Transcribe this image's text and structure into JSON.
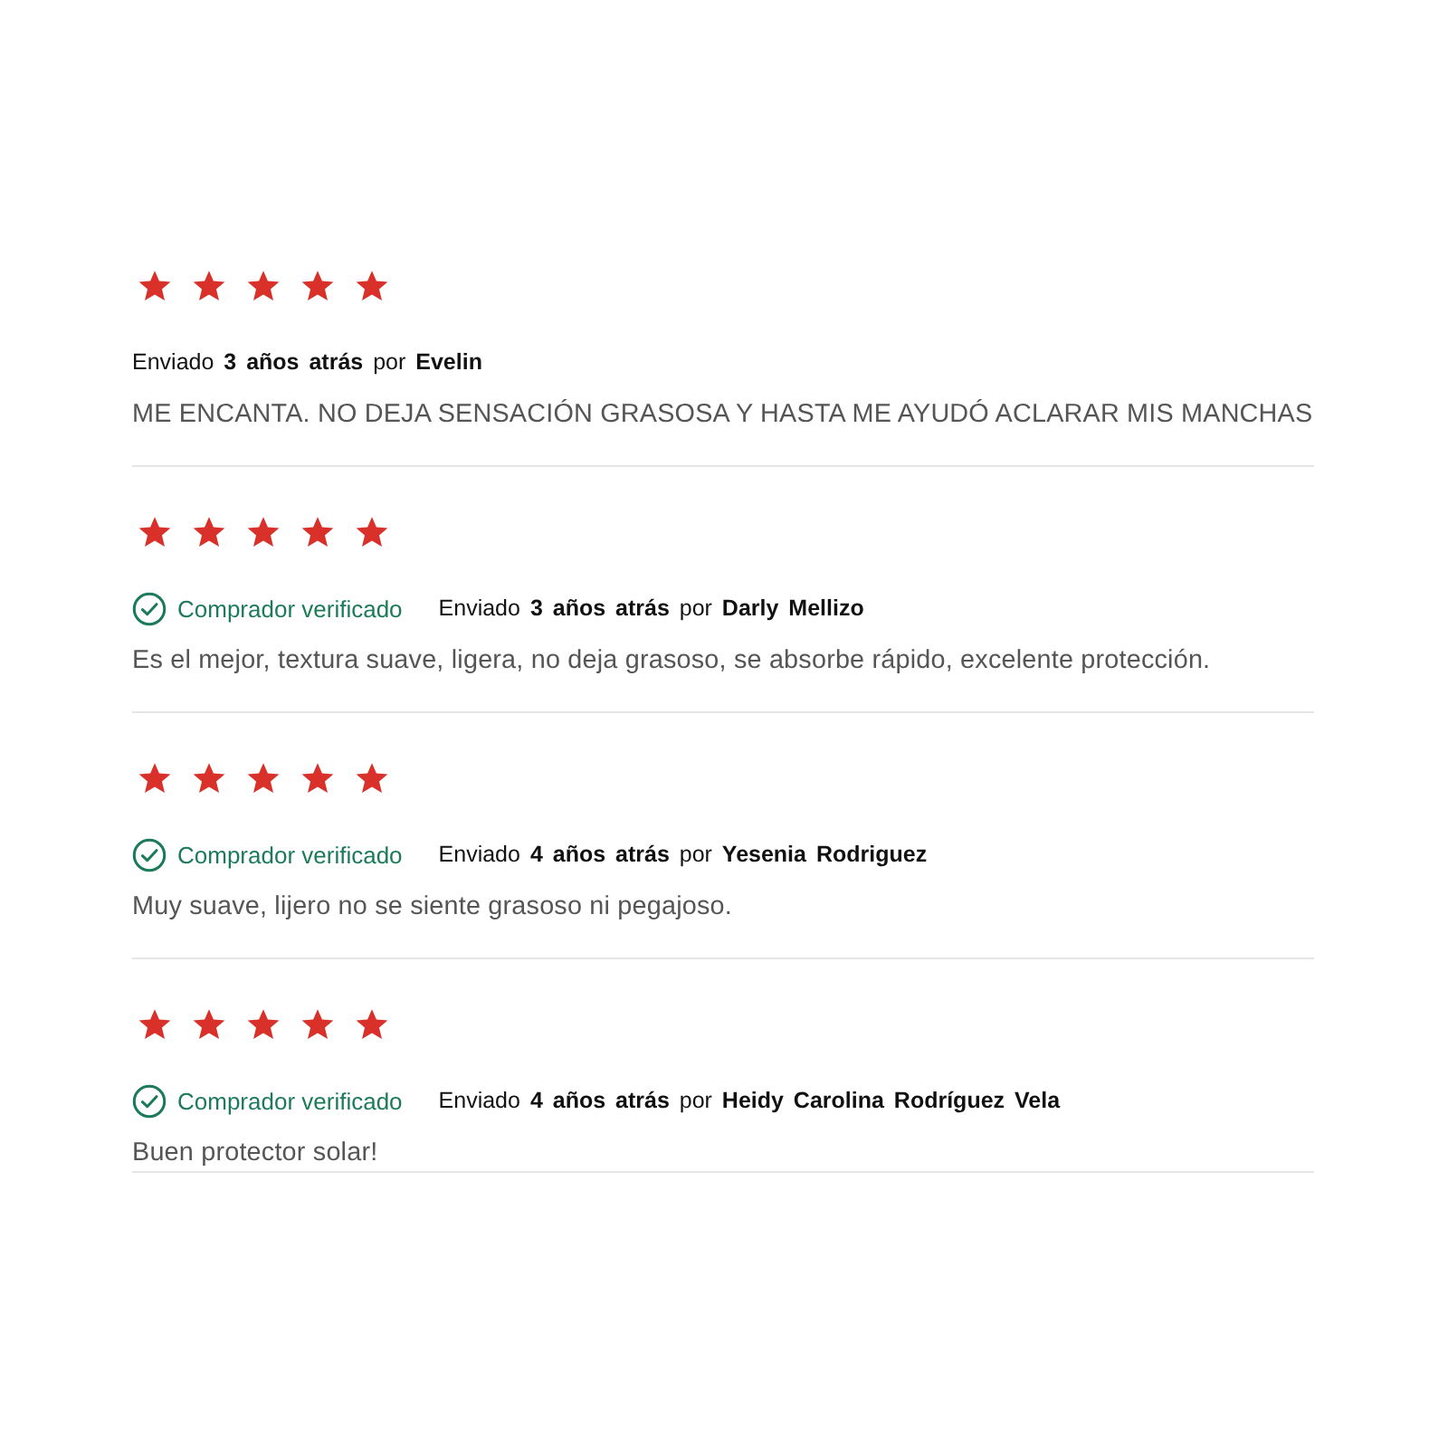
{
  "reviews": [
    {
      "stars": 5,
      "meta": "Enviado **3 años atrás** por **Evelin**",
      "text": "ME ENCANTA. NO DEJA SENSACIÓN GRASOSA Y HASTA ME AYUDÓ ACLARAR MIS MANCHAS"
    },
    {
      "stars": 5,
      "verified_badge": "Comprador verificado",
      "meta": "Enviado **3 años atrás** por **Darly Mellizo**",
      "text": "Es el mejor, textura suave, ligera, no deja grasoso, se absorbe rápido, excelente protección."
    },
    {
      "stars": 5,
      "verified_badge": "Comprador verificado",
      "meta": "Enviado **4 años atrás** por **Yesenia Rodriguez**",
      "text": "Muy suave, lijero no se siente grasoso ni pegajoso."
    },
    {
      "stars": 5,
      "verified_badge": "Comprador verificado",
      "meta": "Enviado **4 años atrás** por **Heidy Carolina Rodríguez Vela**",
      "text": "Buen protector solar!"
    }
  ]
}
